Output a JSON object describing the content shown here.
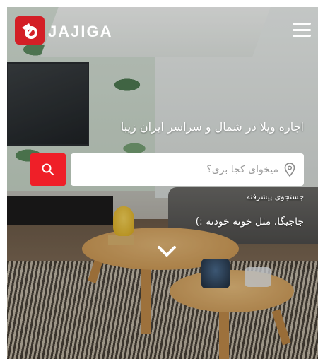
{
  "header": {
    "logo_text": "JAJIGA",
    "logo_icon": "jajiga-logo-icon",
    "menu_icon": "hamburger-menu-icon"
  },
  "hero": {
    "headline": "اجاره ویلا در شمال و سراسر ایران زیبا",
    "tagline": "جاجیگا، مثل خونه خودته :)"
  },
  "search": {
    "placeholder": "میخوای کجا بری؟",
    "location_icon": "map-pin-icon",
    "button_icon": "search-icon",
    "advanced_label": "جستجوی پیشرفته"
  },
  "scroll": {
    "icon": "chevron-down-icon"
  },
  "colors": {
    "brand_red": "#d31f26",
    "search_button": "#ef1f28"
  }
}
